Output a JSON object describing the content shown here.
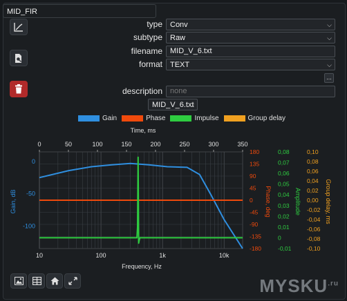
{
  "tab": {
    "title": "MID_FIR"
  },
  "form": {
    "type_label": "type",
    "type_value": "Conv",
    "subtype_label": "subtype",
    "subtype_value": "Raw",
    "filename_label": "filename",
    "filename_value": "MID_V_6.txt",
    "format_label": "format",
    "format_value": "TEXT",
    "browse_label": "...",
    "description_label": "description",
    "description_placeholder": "none",
    "file_select_value": "MID_V_6.txt"
  },
  "legend": [
    {
      "label": "Gain",
      "color": "#2f8fe0"
    },
    {
      "label": "Phase",
      "color": "#f04a0c"
    },
    {
      "label": "Impulse",
      "color": "#2ecc40"
    },
    {
      "label": "Group delay",
      "color": "#f0a020"
    }
  ],
  "toolbar": {
    "icons": [
      "save-image-icon",
      "table-icon",
      "home-icon",
      "fullscreen-icon"
    ]
  },
  "side_icons": [
    "chart-line-icon",
    "file-search-icon",
    "trash-icon"
  ],
  "watermark": {
    "text": "MYSKU",
    "suffix": ".ru"
  },
  "chart_data": {
    "type": "line",
    "top_axis": {
      "label": "Time, ms",
      "ticks": [
        "0",
        "50",
        "100",
        "150",
        "200",
        "250",
        "300",
        "350"
      ],
      "range": [
        0,
        350
      ]
    },
    "x": {
      "label": "Frequency, Hz",
      "scale": "log",
      "range": [
        10,
        20000
      ],
      "ticks": [
        "10",
        "100",
        "1k",
        "10k"
      ]
    },
    "gain_axis": {
      "label": "Gain, dB",
      "range": [
        -135,
        15
      ],
      "ticks": [
        "0",
        "-50",
        "-100"
      ]
    },
    "phase_axis": {
      "label": "Phase, deg",
      "range": [
        -180,
        180
      ],
      "ticks": [
        "180",
        "135",
        "90",
        "45",
        "0",
        "-45",
        "-90",
        "-135",
        "-180"
      ]
    },
    "amplitude_axis": {
      "label": "Amplitude",
      "range": [
        -0.01,
        0.08
      ],
      "ticks": [
        "0,08",
        "0,07",
        "0,06",
        "0,05",
        "0,04",
        "0,03",
        "0,02",
        "0,01",
        "0",
        "-0,01"
      ]
    },
    "group_delay_axis": {
      "label": "Group delay, ms",
      "range": [
        -0.1,
        0.1
      ],
      "ticks": [
        "0,10",
        "0,08",
        "0,06",
        "0,04",
        "0,02",
        "0,00",
        "-0,02",
        "-0,04",
        "-0,06",
        "-0,08",
        "-0,10"
      ]
    },
    "grid": true,
    "series": [
      {
        "name": "Gain",
        "axis": "gain",
        "points": [
          [
            10,
            -25
          ],
          [
            30,
            -14
          ],
          [
            70,
            -8
          ],
          [
            150,
            -5
          ],
          [
            300,
            -3
          ],
          [
            600,
            -5
          ],
          [
            1200,
            -8
          ],
          [
            2500,
            -9
          ],
          [
            4000,
            -20
          ],
          [
            6000,
            -50
          ],
          [
            10000,
            -90
          ],
          [
            20000,
            -135
          ]
        ]
      },
      {
        "name": "Phase",
        "axis": "phase",
        "points": [
          [
            10,
            0
          ],
          [
            20000,
            0
          ]
        ]
      },
      {
        "name": "Impulse",
        "axis": "time",
        "points": [
          [
            0,
            0
          ],
          [
            168,
            0
          ],
          [
            169,
            0.01
          ],
          [
            170,
            0.075
          ],
          [
            171,
            -0.005
          ],
          [
            172,
            -0.002
          ],
          [
            173,
            0
          ],
          [
            350,
            0
          ]
        ]
      }
    ]
  }
}
